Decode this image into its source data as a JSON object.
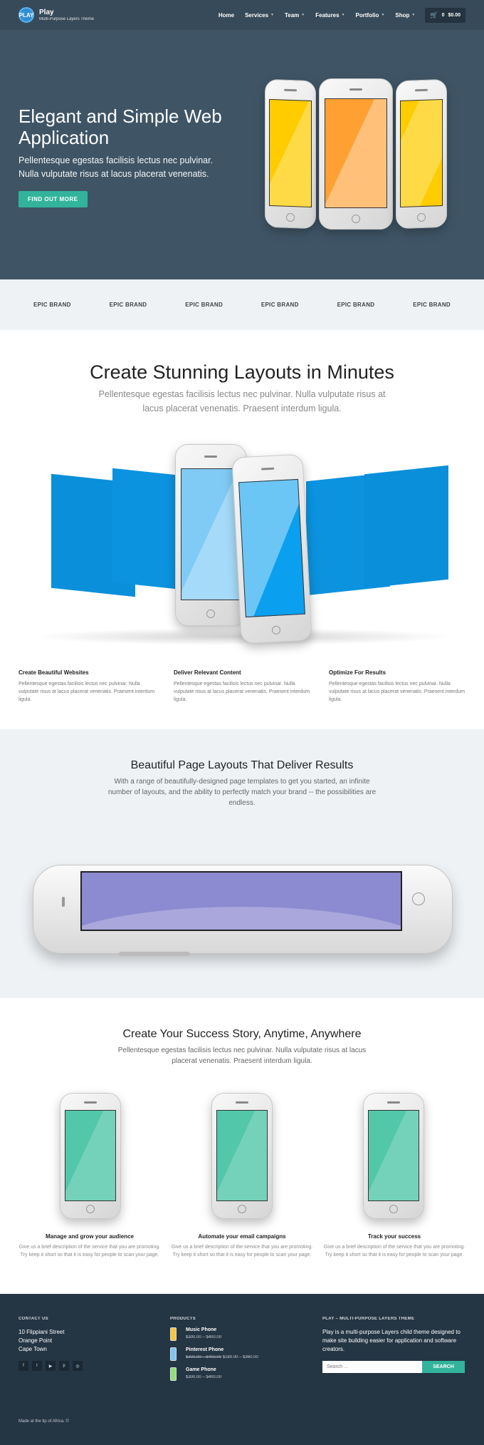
{
  "header": {
    "logo_badge": "PLAY",
    "site_title": "Play",
    "site_tagline": "Multi-Purpose Layers Theme",
    "nav": [
      {
        "label": "Home",
        "has_dropdown": false
      },
      {
        "label": "Services",
        "has_dropdown": true
      },
      {
        "label": "Team",
        "has_dropdown": true
      },
      {
        "label": "Features",
        "has_dropdown": true
      },
      {
        "label": "Portfolio",
        "has_dropdown": true
      },
      {
        "label": "Shop",
        "has_dropdown": true
      }
    ],
    "cart": {
      "count": "0",
      "total": "$0.00"
    }
  },
  "hero": {
    "title": "Elegant and Simple Web Application",
    "text": "Pellentesque egestas facilisis lectus nec pulvinar. Nulla vulputate risus at lacus placerat venenatis.",
    "button": "FIND OUT MORE"
  },
  "brands": [
    "EPIC BRAND",
    "EPIC BRAND",
    "EPIC BRAND",
    "EPIC BRAND",
    "EPIC BRAND",
    "EPIC BRAND"
  ],
  "layouts": {
    "title": "Create Stunning Layouts in Minutes",
    "lead": "Pellentesque egestas facilisis lectus nec pulvinar. Nulla vulputate risus at lacus placerat venenatis. Praesent interdum ligula.",
    "columns": [
      {
        "title": "Create Beautiful Websites",
        "text": "Pellentesque egestas facilisis lectus nec pulvinar. Nulla vulputate risus at lacus placerat venenatis. Praesent interdum ligula."
      },
      {
        "title": "Deliver Relevant Content",
        "text": "Pellentesque egestas facilisis lectus nec pulvinar. Nulla vulputate risus at lacus placerat venenatis. Praesent interdum ligula."
      },
      {
        "title": "Optimize For Results",
        "text": "Pellentesque egestas facilisis lectus nec pulvinar. Nulla vulputate risus at lacus placerat venenatis. Praesent interdum ligula."
      }
    ]
  },
  "results": {
    "title": "Beautiful Page Layouts That Deliver Results",
    "lead": "With a range of beautifully-designed page templates to get you started, an infinite number of layouts, and the ability to perfectly match your brand -- the possibilities are endless."
  },
  "success": {
    "title": "Create Your Success Story, Anytime, Anywhere",
    "lead": "Pellentesque egestas facilisis lectus nec pulvinar. Nulla vulputate risus at lacus placerat venenatis. Praesent interdum ligula.",
    "features": [
      {
        "title": "Manage and grow your audience",
        "text": "Give us a brief description of the service that you are promoting. Try keep it short so that it is easy for people to scan your page."
      },
      {
        "title": "Automate your email campaigns",
        "text": "Give us a brief description of the service that you are promoting. Try keep it short so that it is easy for people to scan your page."
      },
      {
        "title": "Track your success",
        "text": "Give us a brief description of the service that you are promoting. Try keep it short so that it is easy for people to scan your page."
      }
    ]
  },
  "footer": {
    "contact_heading": "CONTACT US",
    "address": [
      "10 Flippiani Street",
      "Orange Point",
      "Cape Town"
    ],
    "social_icons": [
      "facebook-icon",
      "twitter-icon",
      "youtube-icon",
      "pinterest-icon",
      "dribbble-icon"
    ],
    "products_heading": "PRODUCTS",
    "products": [
      {
        "name": "Music Phone",
        "price": "$300.00 – $400.00",
        "old_price": "",
        "color": "#f5c542"
      },
      {
        "name": "Pinterest Phone",
        "price": "$180.00 – $360.00",
        "old_price": "$300.00 – $400.00",
        "color": "#7fc4f0"
      },
      {
        "name": "Game Phone",
        "price": "$300.00 – $400.00",
        "old_price": "",
        "color": "#8fdc7a"
      }
    ],
    "about_heading": "PLAY – MULTI-PURPOSE LAYERS THEME",
    "about_text": "Play is a multi-purpose Layers child theme designed to make site building easier for application and software creators.",
    "search_placeholder": "Search ...",
    "search_button": "SEARCH",
    "copyright": "Made at the tip of Africa. ©"
  },
  "colors": {
    "hero_bg": "#3f5566",
    "accent_green": "#32b49c",
    "panel_blue": "#0a8fda",
    "footer_bg": "#243544",
    "light_bg": "#eef2f5"
  }
}
